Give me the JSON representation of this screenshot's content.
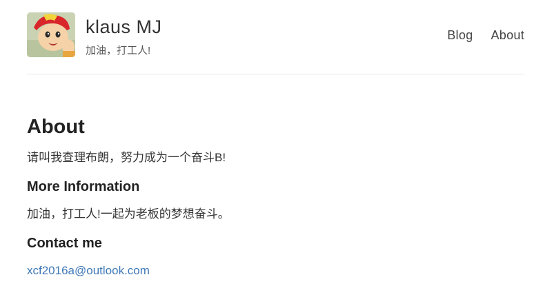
{
  "header": {
    "avatar_alt": "avatar",
    "title": "klaus MJ",
    "tagline": "加油，打工人!"
  },
  "nav": {
    "items": [
      {
        "label": "Blog"
      },
      {
        "label": "About"
      }
    ]
  },
  "main": {
    "heading": "About",
    "intro": "请叫我查理布朗，努力成为一个奋斗B!",
    "more_info_heading": "More Information",
    "more_info_text": "加油，打工人!一起为老板的梦想奋斗。",
    "contact_heading": "Contact me",
    "contact_email": "xcf2016a@outlook.com"
  },
  "colors": {
    "link": "#3f78b7",
    "text": "#333333",
    "divider": "#e8e8e8"
  }
}
